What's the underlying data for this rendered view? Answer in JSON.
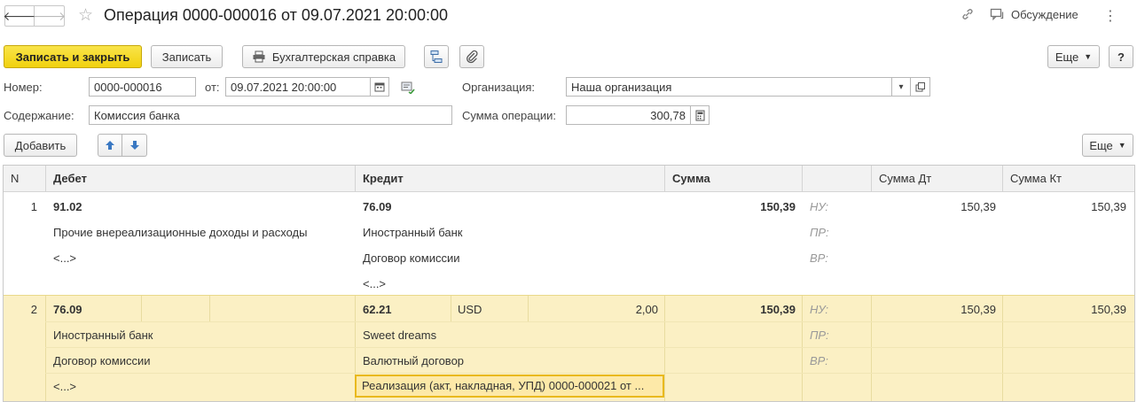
{
  "window": {
    "title": "Операция 0000-000016 от 09.07.2021 20:00:00",
    "discuss_label": "Обсуждение"
  },
  "toolbar": {
    "save_close_label": "Записать и закрыть",
    "save_label": "Записать",
    "accounting_note_label": "Бухгалтерская справка",
    "more_label": "Еще",
    "help_label": "?"
  },
  "form": {
    "number_label": "Номер:",
    "number_value": "0000-000016",
    "date_label": "от:",
    "date_value": "09.07.2021 20:00:00",
    "org_label": "Организация:",
    "org_value": "Наша организация",
    "content_label": "Содержание:",
    "content_value": "Комиссия банка",
    "sum_label": "Сумма операции:",
    "sum_value": "300,78"
  },
  "table_toolbar": {
    "add_label": "Добавить",
    "more_label": "Еще"
  },
  "table": {
    "headers": {
      "n": "N",
      "debit": "Дебет",
      "credit": "Кредит",
      "sum": "Сумма",
      "sum_dt": "Сумма Дт",
      "sum_kt": "Сумма Кт"
    },
    "rows": [
      {
        "n": "1",
        "debit_account": "91.02",
        "debit_sub1": "Прочие внереализационные доходы и расходы",
        "debit_sub2": "<...>",
        "credit_account": "76.09",
        "credit_sub1": "Иностранный банк",
        "credit_sub2": "Договор комиссии",
        "credit_sub3": "<...>",
        "sum": "150,39",
        "nu_label": "НУ:",
        "pr_label": "ПР:",
        "vr_label": "ВР:",
        "nu_dt": "150,39",
        "nu_kt": "150,39"
      },
      {
        "n": "2",
        "debit_account": "76.09",
        "debit_sub1": "Иностранный банк",
        "debit_sub2": "Договор комиссии",
        "debit_sub3": "<...>",
        "credit_account": "62.21",
        "credit_currency": "USD",
        "credit_currency_amount": "2,00",
        "credit_sub1": "Sweet dreams",
        "credit_sub2": "Валютный договор",
        "credit_sub3": "Реализация (акт, накладная, УПД) 0000-000021 от ...",
        "sum": "150,39",
        "nu_label": "НУ:",
        "pr_label": "ПР:",
        "vr_label": "ВР:",
        "nu_dt": "150,39",
        "nu_kt": "150,39"
      }
    ]
  }
}
